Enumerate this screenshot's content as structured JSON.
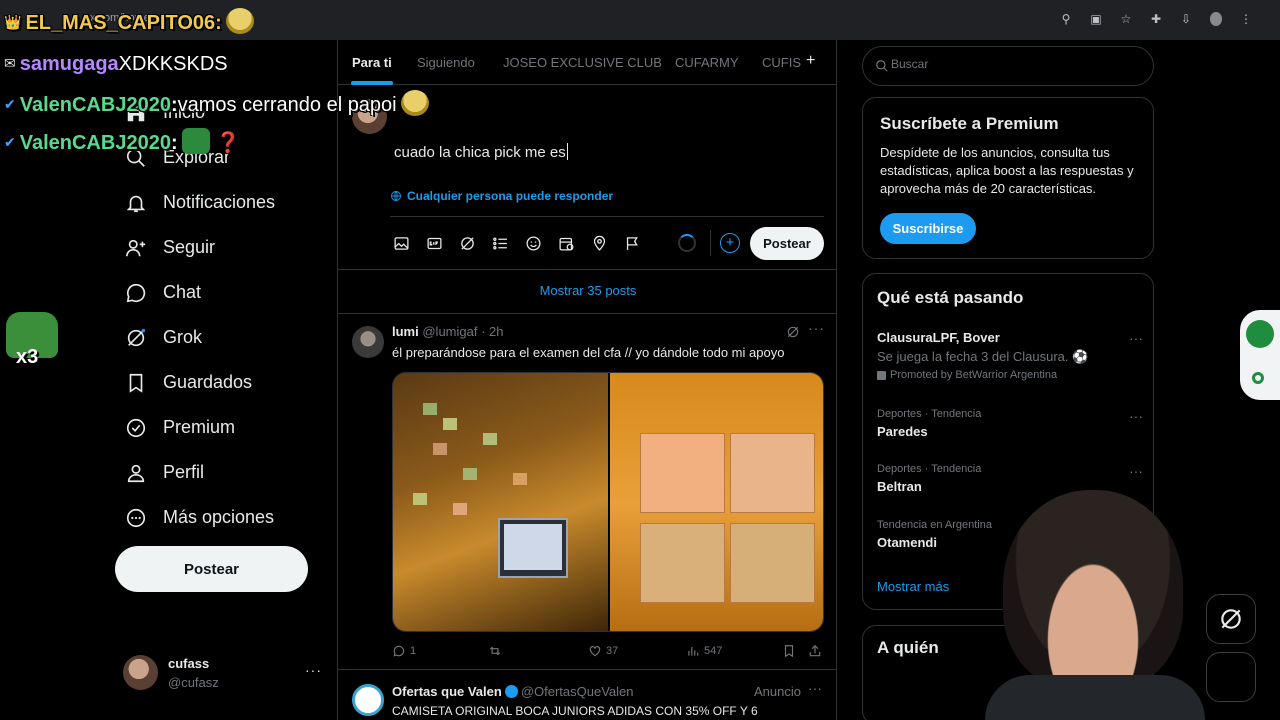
{
  "browser": {
    "url": "x.com/home"
  },
  "nav": {
    "items": [
      {
        "label": "Inicio",
        "icon": "home-icon"
      },
      {
        "label": "Explorar",
        "icon": "search-icon"
      },
      {
        "label": "Notificaciones",
        "icon": "bell-icon"
      },
      {
        "label": "Seguir",
        "icon": "person-plus-icon"
      },
      {
        "label": "Chat",
        "icon": "chat-bubble-icon"
      },
      {
        "label": "Grok",
        "icon": "grok-icon"
      },
      {
        "label": "Guardados",
        "icon": "bookmark-icon"
      },
      {
        "label": "Premium",
        "icon": "premium-badge-icon"
      },
      {
        "label": "Perfil",
        "icon": "person-icon"
      },
      {
        "label": "Más opciones",
        "icon": "more-circle-icon"
      }
    ],
    "post_button": "Postear"
  },
  "account": {
    "name": "cufass",
    "handle": "@cufasz",
    "more": "···"
  },
  "tabs": [
    {
      "label": "Para ti",
      "active": true
    },
    {
      "label": "Siguiendo",
      "active": false
    },
    {
      "label": "JOSEO EXCLUSIVE CLUB",
      "active": false
    },
    {
      "label": "CUFARMY",
      "active": false
    },
    {
      "label": "CUFIS",
      "active": false
    }
  ],
  "tab_add": "+",
  "composer": {
    "text": "cuado la chica pick me es",
    "reply_setting": "Cualquier persona puede responder",
    "post_button": "Postear",
    "tools": [
      "image-icon",
      "gif-icon",
      "grok-icon",
      "list-icon",
      "emoji-icon",
      "schedule-icon",
      "location-icon",
      "flag-icon"
    ]
  },
  "show_posts": "Mostrar 35 posts",
  "tweet": {
    "name": "lumi",
    "handle": "@lumigaf",
    "time": "2h",
    "text": "él preparándose para el examen del cfa // yo dándole todo mi apoyo",
    "replies": "1",
    "retweets": "",
    "likes": "37",
    "views": "547"
  },
  "ad": {
    "name": "Ofertas que Valen",
    "handle": "@OfertasQueValen",
    "label": "Anuncio",
    "text": "CAMISETA ORIGINAL BOCA JUNIORS ADIDAS CON 35% OFF Y 6"
  },
  "search": {
    "placeholder": "Buscar"
  },
  "premium": {
    "title": "Suscríbete a Premium",
    "description": "Despídete de los anuncios, consulta tus estadísticas, aplica boost a las respuestas y aprovecha más de 20 características.",
    "button": "Suscribirse"
  },
  "trends": {
    "title": "Qué está pasando",
    "items": [
      {
        "context": "",
        "name": "ClausuraLPF, Bover",
        "desc": "Se juega la fecha 3 del Clausura. ⚽",
        "promo": "Promoted by BetWarrior Argentina"
      },
      {
        "context": "Deportes · Tendencia",
        "name": "Paredes"
      },
      {
        "context": "Deportes · Tendencia",
        "name": "Beltran"
      },
      {
        "context": "Tendencia en Argentina",
        "name": "Otamendi"
      }
    ],
    "show_more": "Mostrar más"
  },
  "who_to_follow": {
    "title": "A quién"
  },
  "chat": [
    {
      "user": "EL_MAS_CAPITO06",
      "message": "",
      "user_color": "#f2c94c",
      "badge": "👑"
    },
    {
      "user": "samugaga",
      "message": "XDKKSKDS",
      "user_color": "#b388ff",
      "badge": "✉"
    },
    {
      "user": "ValenCABJ2020",
      "message": "vamos cerrando el papoi",
      "user_color": "#59d98e",
      "badge": "✔"
    },
    {
      "user": "ValenCABJ2020",
      "message": "",
      "user_color": "#59d98e",
      "badge": "✔"
    }
  ],
  "chat_emote_count": "x3",
  "colors": {
    "accent": "#1d9bf0",
    "background": "#000000",
    "text": "#e7e9ea",
    "muted": "#71767b",
    "border": "#2f3336"
  }
}
